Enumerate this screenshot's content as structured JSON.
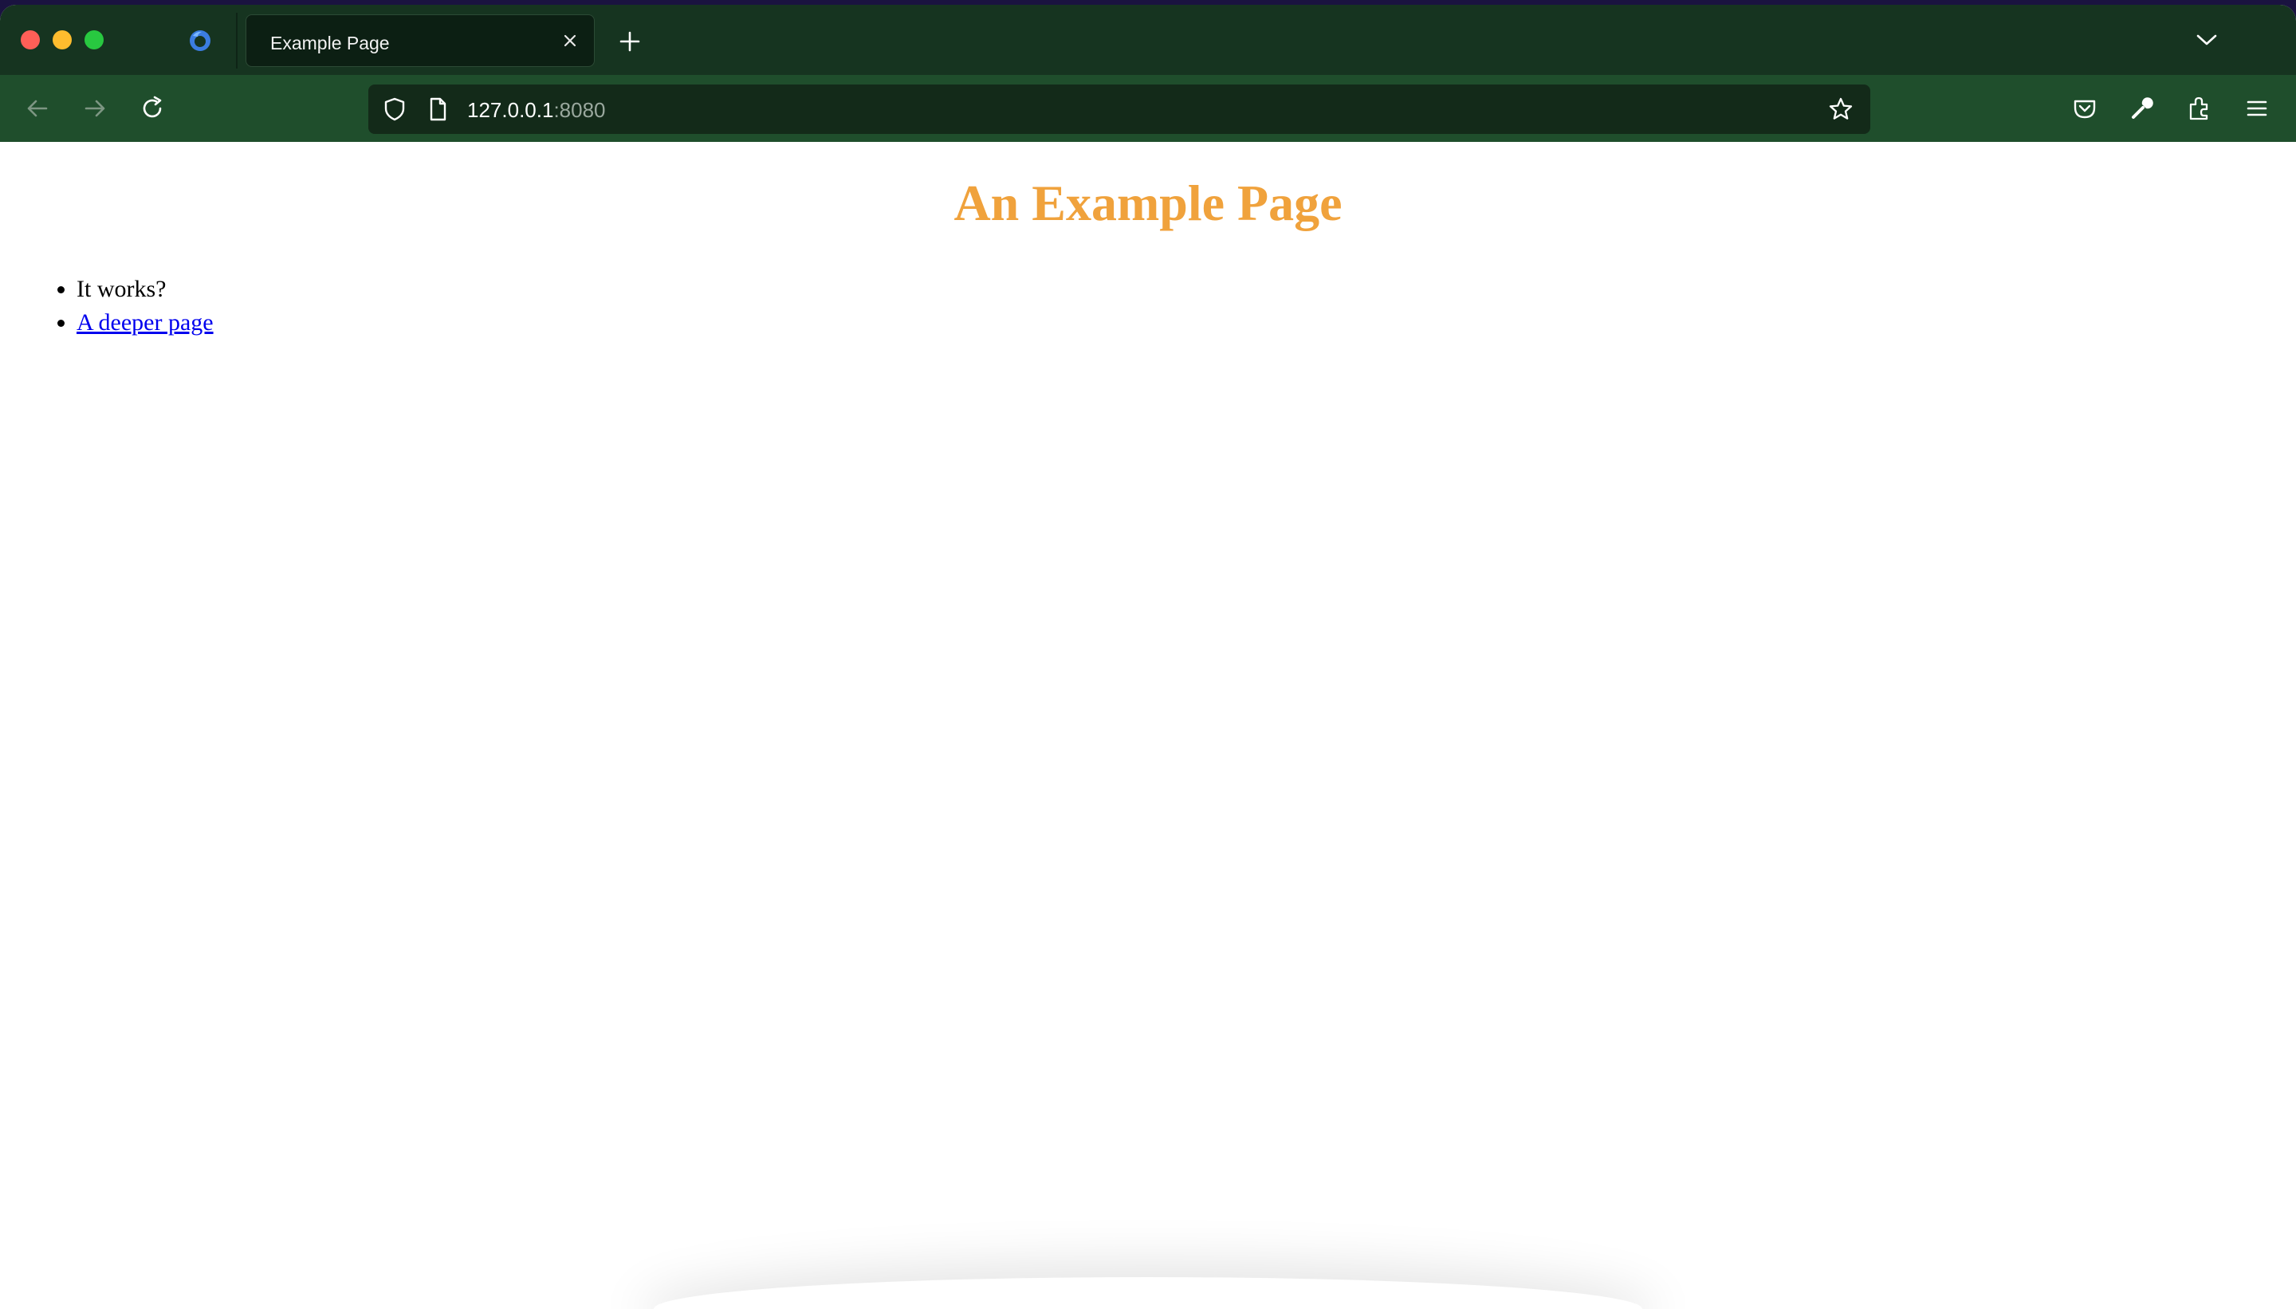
{
  "browser": {
    "tab": {
      "title": "Example Page"
    },
    "urlbar": {
      "host": "127.0.0.1",
      "port": ":8080"
    },
    "icons": {
      "firefox": "firefox-logo-icon",
      "close_tab": "close-icon",
      "new_tab": "plus-icon",
      "tab_list": "chevron-down-icon",
      "back": "back-arrow-icon",
      "forward": "forward-arrow-icon",
      "reload": "reload-icon",
      "tracking": "shield-icon",
      "page_info": "page-icon",
      "bookmark": "star-icon",
      "pocket": "pocket-icon",
      "devtools": "wrench-icon",
      "extensions": "puzzle-icon",
      "menu": "hamburger-menu-icon"
    },
    "colors": {
      "tabstrip": "#163420",
      "toolbar": "#1f4e2c",
      "urlbar": "#132a19"
    }
  },
  "page": {
    "heading": "An Example Page",
    "heading_color": "#f0a23c",
    "items": [
      {
        "text": "It works?"
      },
      {
        "link": "A deeper page"
      }
    ]
  }
}
